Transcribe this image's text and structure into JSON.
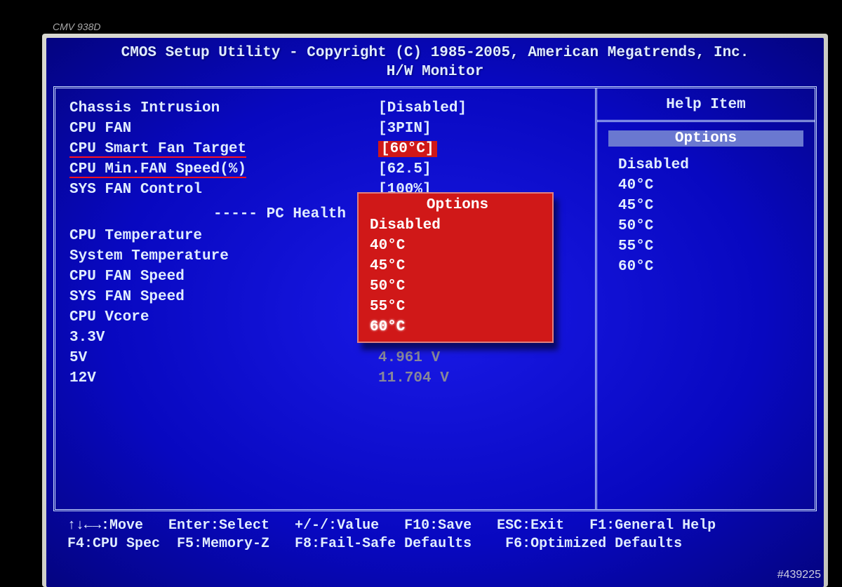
{
  "monitor_model": "CMV 938D",
  "header1": "CMOS Setup Utility - Copyright (C) 1985-2005, American Megatrends, Inc.",
  "header2": "H/W Monitor",
  "settings": [
    {
      "label": "Chassis Intrusion",
      "value": "[Disabled]",
      "underline": false,
      "highlight": false
    },
    {
      "label": "CPU FAN",
      "value": "[3PIN]",
      "underline": false,
      "highlight": false
    },
    {
      "label": "CPU Smart Fan Target",
      "value": "[60°C]",
      "underline": true,
      "highlight": true
    },
    {
      "label": "CPU Min.FAN Speed(%)",
      "value": "[62.5]",
      "underline": true,
      "highlight": false
    },
    {
      "label": "SYS FAN Control",
      "value": "[100%]",
      "underline": false,
      "highlight": false
    }
  ],
  "section_title": "----- PC Health",
  "health": [
    {
      "label": "CPU Temperature",
      "value": ""
    },
    {
      "label": "System Temperature",
      "value": ""
    },
    {
      "label": "CPU FAN Speed",
      "value": ""
    },
    {
      "label": "SYS FAN Speed",
      "value": ""
    },
    {
      "label": "CPU Vcore",
      "value": ""
    },
    {
      "label": "3.3V",
      "value": ""
    },
    {
      "label": "5V",
      "value": "4.961 V"
    },
    {
      "label": "12V",
      "value": "11.704 V"
    }
  ],
  "popup": {
    "title": "Options",
    "items": [
      "Disabled",
      "40°C",
      "45°C",
      "50°C",
      "55°C",
      "60°C"
    ],
    "selected": "60°C"
  },
  "help": {
    "title": "Help Item",
    "options_label": "Options",
    "items": [
      "Disabled",
      "40°C",
      "45°C",
      "50°C",
      "55°C",
      "60°C"
    ]
  },
  "footer": {
    "line1": "↑↓←→:Move   Enter:Select   +/-/:Value   F10:Save   ESC:Exit   F1:General Help",
    "line2": "F4:CPU Spec  F5:Memory-Z   F8:Fail-Safe Defaults    F6:Optimized Defaults"
  },
  "watermark": "#439225"
}
